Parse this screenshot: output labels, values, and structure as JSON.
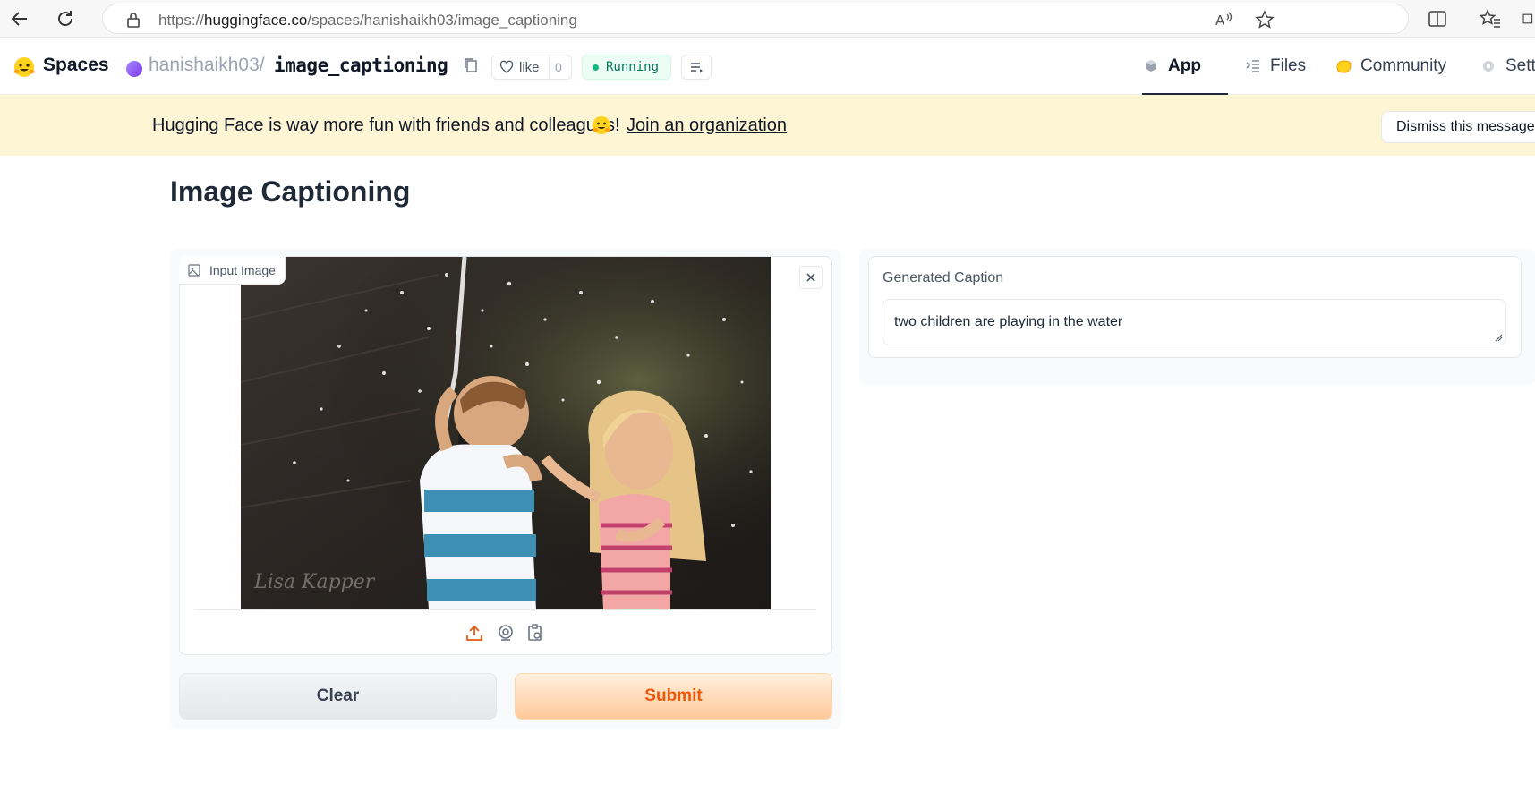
{
  "browser": {
    "url_prefix": "https://",
    "url_host": "huggingface.co",
    "url_path": "/spaces/hanishaikh03/image_captioning"
  },
  "header": {
    "brand": "Spaces",
    "owner": "hanishaikh03",
    "separator": "/",
    "repo": "image_captioning",
    "like_label": "like",
    "like_count": "0",
    "status": "Running",
    "tabs": [
      {
        "label": "App",
        "icon": "cube-icon"
      },
      {
        "label": "Files",
        "icon": "files-icon"
      },
      {
        "label": "Community",
        "icon": "community-icon"
      },
      {
        "label": "Settings",
        "icon": "gear-icon"
      }
    ]
  },
  "banner": {
    "text": "Hugging Face is way more fun with friends and colleagues!",
    "link": "Join an organization",
    "dismiss": "Dismiss this message"
  },
  "main": {
    "title": "Image Captioning",
    "input_label": "Input Image",
    "output_label": "Generated Caption",
    "output_value": "two children are playing in the water",
    "clear": "Clear",
    "submit": "Submit",
    "watermark": "Lisa Kapper"
  },
  "colors": {
    "accent": "#ea580c",
    "status_green": "#10b981",
    "banner_bg": "#fdf5d3"
  }
}
